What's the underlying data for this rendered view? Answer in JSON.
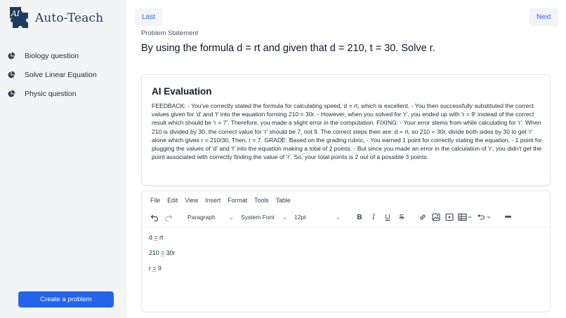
{
  "app": {
    "logo_text": "Auto-Teach",
    "logo_mark": "AI"
  },
  "sidebar": {
    "items": [
      {
        "label": "Biology question",
        "icon": "pie-chart-icon"
      },
      {
        "label": "Solve Linear Equation",
        "icon": "pie-chart-icon"
      },
      {
        "label": "Physic question",
        "icon": "pie-chart-icon"
      }
    ],
    "create_label": "Create a problem"
  },
  "header": {
    "last_label": "Last",
    "next_label": "Next"
  },
  "problem": {
    "label": "Problem Statement",
    "text": "By using the formula d = rt and given that d = 210, t = 30. Solve r."
  },
  "evaluation": {
    "title": "AI Evaluation",
    "body": "FEEDBACK: - You've correctly stated the formula for calculating speed, d = rt, which is excellent. - You then successfully substituted the correct values given for 'd' and 't' into the equation forming 210 = 30r. - However, when you solved for 'r', you ended up with 'r = 9' instead of the correct result which should be 'r = 7'. Therefore, you made a slight error in the computation. FIXING: - Your error stems from while calculating for 'r'. When 210 is divided by 30, the correct value for 'r' should be 7, not 9. The correct steps then are: d = rt, so 210 = 30r, divide both sides by 30 to get 'r' alone which gives r = 210/30, Then, r = 7. GRADE: Based on the grading rubric, - You earned 1 point for correctly stating the equation, - 1 point for plugging the values of 'd' and 't' into the equation making a total of 2 points. - But since you made an error in the calculation of 'r', you didn't get the point associated with correctly finding the value of 'r'. So, your total points is 2 out of a possible 3 points."
  },
  "editor": {
    "menu": [
      "File",
      "Edit",
      "View",
      "Insert",
      "Format",
      "Tools",
      "Table"
    ],
    "block_format": "Paragraph",
    "font_family": "System Font",
    "font_size": "12pt",
    "lines": [
      {
        "a": "d",
        "op": "=",
        "b": "rt"
      },
      {
        "a": "210",
        "op": "=",
        "b": "30r"
      },
      {
        "a": "r",
        "op": "=",
        "b": "9"
      }
    ]
  },
  "colors": {
    "accent": "#2563eb",
    "sidebar_bg": "#f3f4f6"
  }
}
